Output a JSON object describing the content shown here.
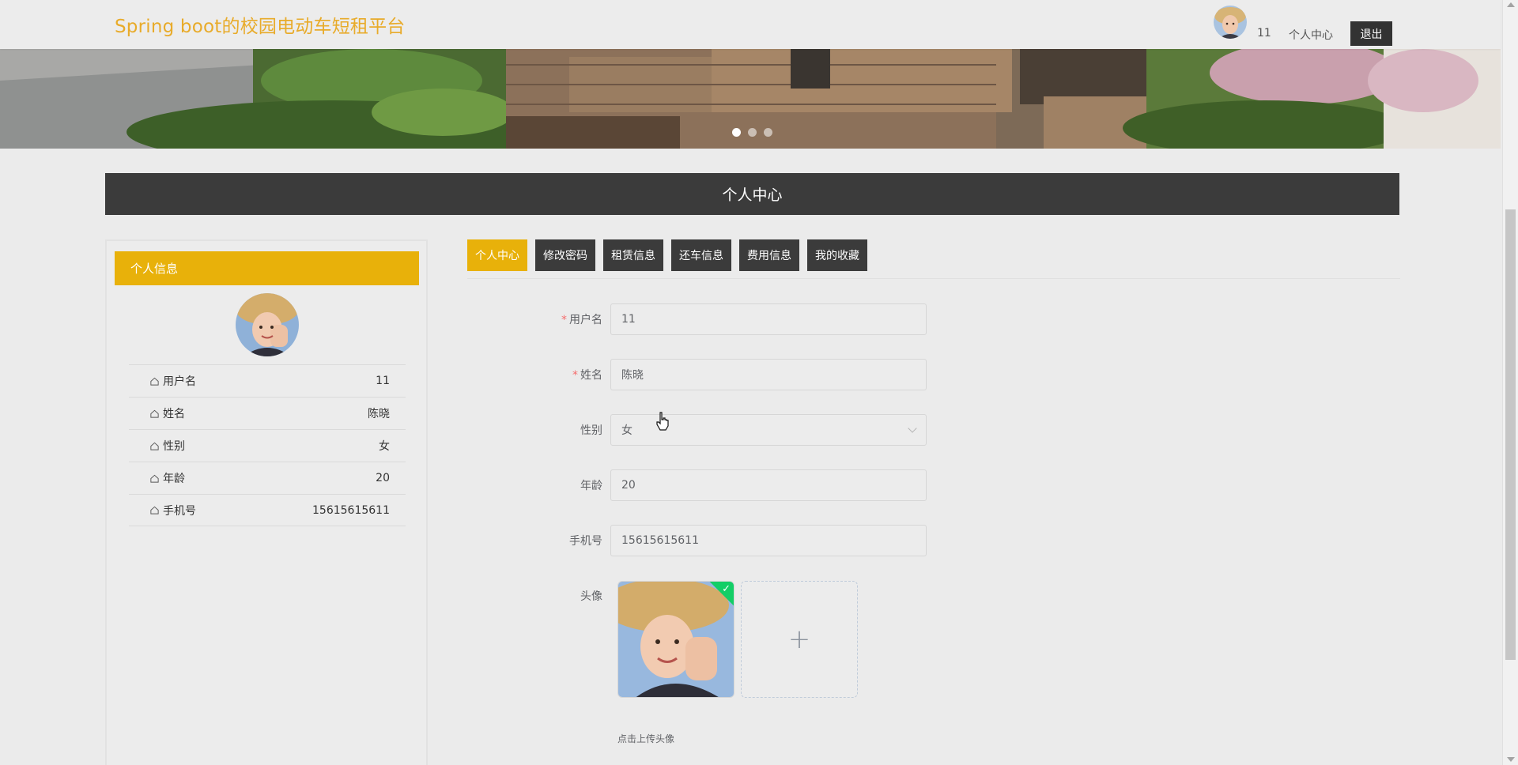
{
  "header": {
    "title": "Spring boot的校园电动车短租平台",
    "username": "11",
    "center_link": "个人中心",
    "logout_label": "退出"
  },
  "banner": {
    "slide_count": 3,
    "active_slide": 1
  },
  "section": {
    "title": "个人中心"
  },
  "profile_panel": {
    "heading": "个人信息",
    "rows": [
      {
        "icon": "home-icon",
        "label": "用户名",
        "value": "11"
      },
      {
        "icon": "home-icon",
        "label": "姓名",
        "value": "陈晓"
      },
      {
        "icon": "home-icon",
        "label": "性别",
        "value": "女"
      },
      {
        "icon": "home-icon",
        "label": "年龄",
        "value": "20"
      },
      {
        "icon": "home-icon",
        "label": "手机号",
        "value": "15615615611"
      }
    ]
  },
  "tabs": [
    {
      "label": "个人中心",
      "active": true
    },
    {
      "label": "修改密码",
      "active": false
    },
    {
      "label": "租赁信息",
      "active": false
    },
    {
      "label": "还车信息",
      "active": false
    },
    {
      "label": "费用信息",
      "active": false
    },
    {
      "label": "我的收藏",
      "active": false
    }
  ],
  "form": {
    "username": {
      "label": "用户名",
      "required": true,
      "value": "11"
    },
    "name": {
      "label": "姓名",
      "required": true,
      "value": "陈晓"
    },
    "gender": {
      "label": "性别",
      "required": false,
      "value": "女"
    },
    "age": {
      "label": "年龄",
      "required": false,
      "value": "20"
    },
    "phone": {
      "label": "手机号",
      "required": false,
      "value": "15615615611"
    },
    "avatar": {
      "label": "头像",
      "tip": "点击上传头像",
      "uploaded": true
    }
  },
  "colors": {
    "accent": "#e8b10a",
    "title_color": "#e8ab2a",
    "dark": "#3b3b3b",
    "success": "#13ce66",
    "required": "#f56c6c"
  }
}
